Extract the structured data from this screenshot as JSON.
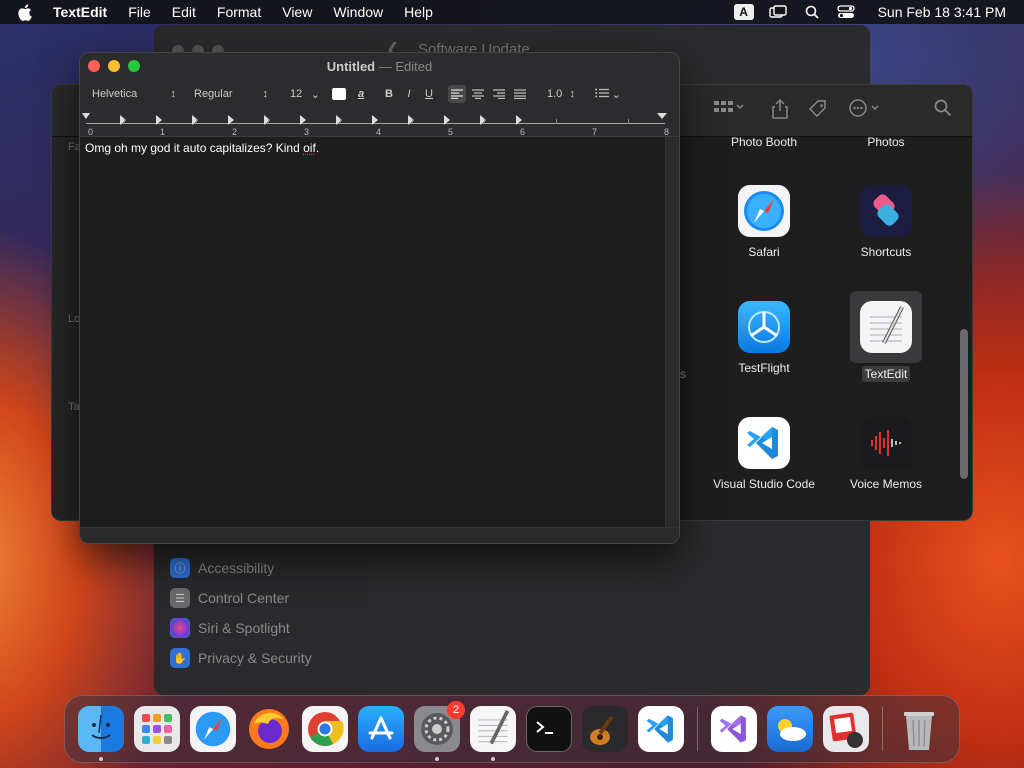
{
  "menubar": {
    "app_name": "TextEdit",
    "menus": [
      "File",
      "Edit",
      "Format",
      "View",
      "Window",
      "Help"
    ],
    "input_source": "A",
    "clock": "Sun Feb 18  3:41 PM"
  },
  "settings_window": {
    "title": "Software Update",
    "sidebar_items": [
      "Accessibility",
      "Control Center",
      "Siri & Spotlight",
      "Privacy & Security"
    ],
    "colors": {
      "accessibility": "#2f6fd6",
      "control_center": "#6a6a6c",
      "siri": "#b04bd0",
      "privacy": "#2f6fd6"
    }
  },
  "finder_window": {
    "partial_labels": [
      "Fa",
      "Lo",
      "Ta"
    ],
    "partial_suffix": "s",
    "apps": [
      {
        "label": "Photo Booth",
        "icon": "photo-booth-icon"
      },
      {
        "label": "Photos",
        "icon": "photos-icon"
      },
      {
        "label": "Safari",
        "icon": "safari-icon"
      },
      {
        "label": "Shortcuts",
        "icon": "shortcuts-icon"
      },
      {
        "label": "TestFlight",
        "icon": "testflight-icon"
      },
      {
        "label": "TextEdit",
        "icon": "textedit-icon",
        "selected": true
      },
      {
        "label": "Visual Studio Code",
        "icon": "vscode-icon"
      },
      {
        "label": "Voice Memos",
        "icon": "voice-memos-icon"
      }
    ]
  },
  "textedit": {
    "title": "Untitled",
    "separator": "—",
    "status": "Edited",
    "font_family": "Helvetica",
    "font_style": "Regular",
    "font_size": "12",
    "bold_label": "B",
    "italic_label": "I",
    "underline_label": "U",
    "line_spacing": "1.0",
    "ruler_numbers": [
      "0",
      "1",
      "2",
      "3",
      "4",
      "5",
      "6",
      "7",
      "8"
    ],
    "body_before": "Omg oh my god it auto capitalizes? Kind ",
    "body_misspelled": "oif",
    "body_after": "."
  },
  "dock": {
    "items": [
      {
        "name": "finder",
        "running": true
      },
      {
        "name": "launchpad",
        "running": false
      },
      {
        "name": "safari",
        "running": false
      },
      {
        "name": "firefox",
        "running": false
      },
      {
        "name": "chrome",
        "running": false
      },
      {
        "name": "app-store",
        "running": false
      },
      {
        "name": "system-settings",
        "running": true,
        "badge": "2"
      },
      {
        "name": "textedit",
        "running": true
      },
      {
        "name": "terminal",
        "running": false
      },
      {
        "name": "garageband",
        "running": false
      },
      {
        "name": "vscode",
        "running": false
      },
      {
        "name": "visual-studio",
        "running": false
      },
      {
        "name": "weather",
        "running": false
      },
      {
        "name": "photo-slideshow",
        "running": false
      },
      {
        "name": "trash",
        "running": false
      }
    ]
  }
}
